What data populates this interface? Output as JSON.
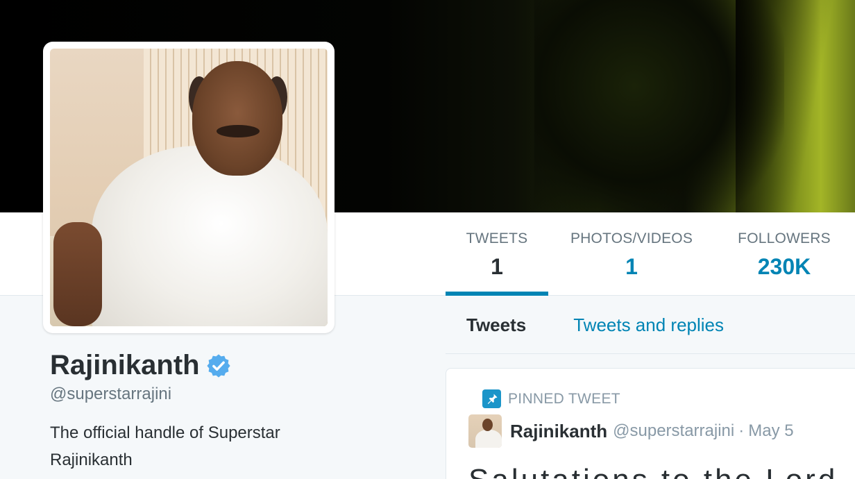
{
  "profile": {
    "name": "Rajinikanth",
    "handle": "@superstarrajini",
    "bio": "The official handle of Superstar Rajinikanth",
    "verified": true
  },
  "stats": [
    {
      "label": "TWEETS",
      "value": "1",
      "active": true
    },
    {
      "label": "PHOTOS/VIDEOS",
      "value": "1",
      "active": false
    },
    {
      "label": "FOLLOWERS",
      "value": "230K",
      "active": false
    }
  ],
  "subtabs": [
    {
      "label": "Tweets",
      "active": true
    },
    {
      "label": "Tweets and replies",
      "active": false
    }
  ],
  "pinned_tweet": {
    "pinned_label": "PINNED TWEET",
    "author_name": "Rajinikanth",
    "author_handle": "@superstarrajini",
    "separator": "·",
    "date": "May 5",
    "text_partial": "Salutations to the Lord"
  },
  "colors": {
    "accent": "#0084b4",
    "text_primary": "#292f33",
    "text_secondary": "#66757f",
    "verified_badge": "#55acee",
    "background": "#f5f8fa"
  },
  "icons": {
    "verified": "verified-badge-icon",
    "pin": "pin-icon"
  }
}
